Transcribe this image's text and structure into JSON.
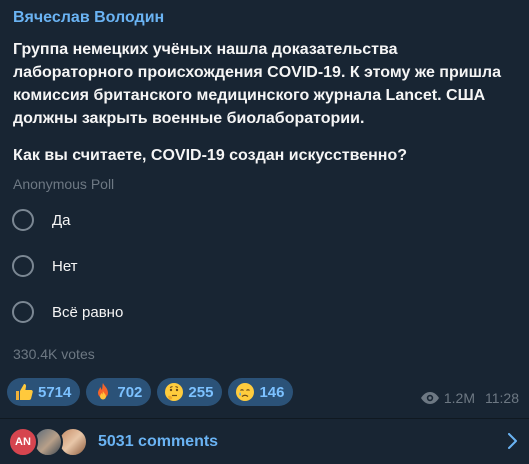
{
  "message": {
    "author": "Вячеслав Володин",
    "text_lines": [
      "Группа немецких учёных нашла доказательства",
      "лабораторного происхождения COVID-19. К этому же пришла",
      "комиссия британского медицинского журнала Lancet. США",
      "должны закрыть военные биолаборатории."
    ],
    "poll": {
      "question": "Как вы считаете, COVID-19 создан искусственно?",
      "type_label": "Anonymous Poll",
      "options": [
        {
          "label": "Да"
        },
        {
          "label": "Нет"
        },
        {
          "label": "Всё равно"
        }
      ],
      "votes": "330.4K votes"
    },
    "reactions": [
      {
        "emoji": "thumbs-up-icon",
        "count": "5714"
      },
      {
        "emoji": "fire-icon",
        "count": "702"
      },
      {
        "emoji": "thinking-face-icon",
        "count": "255"
      },
      {
        "emoji": "crying-face-icon",
        "count": "146"
      }
    ],
    "views": "1.2M",
    "time": "11:28"
  },
  "comments": {
    "avatar_initials": "AN",
    "label": "5031 comments"
  },
  "colors": {
    "background": "#182533",
    "accent": "#6ab3f3",
    "muted": "#6d7883",
    "reaction_bg": "#2b5278"
  }
}
